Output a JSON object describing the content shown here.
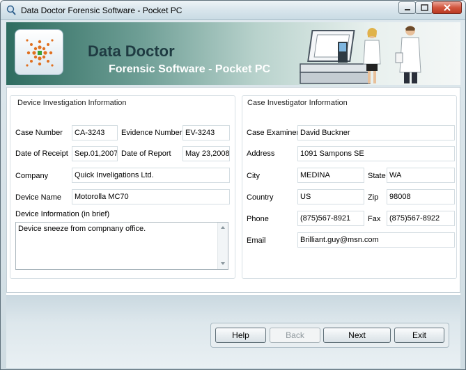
{
  "window": {
    "title": "Data Doctor Forensic Software - Pocket PC"
  },
  "banner": {
    "brand": "Data Doctor",
    "subtitle": "Forensic Software - Pocket PC"
  },
  "device": {
    "section_title": "Device Investigation Information",
    "case_number_label": "Case Number",
    "case_number": "CA-3243",
    "evidence_number_label": "Evidence Number",
    "evidence_number": "EV-3243",
    "date_of_receipt_label": "Date of Receipt",
    "date_of_receipt": "Sep.01,2007",
    "date_of_report_label": "Date of Report",
    "date_of_report": "May 23,2008",
    "company_label": "Company",
    "company": "Quick Inveligations Ltd.",
    "device_name_label": "Device Name",
    "device_name": "Motorolla MC70",
    "info_label": "Device Information (in brief)",
    "info_text": "Device sneeze from compnany office."
  },
  "investigator": {
    "section_title": "Case Investigator Information",
    "examiner_label": "Case Examiner",
    "examiner": "David Buckner",
    "address_label": "Address",
    "address": "1091 Sampons SE",
    "city_label": "City",
    "city": "MEDINA",
    "state_label": "State",
    "state": "WA",
    "country_label": "Country",
    "country": "US",
    "zip_label": "Zip",
    "zip": "98008",
    "phone_label": "Phone",
    "phone": "(875)567-8921",
    "fax_label": "Fax",
    "fax": "(875)567-8922",
    "email_label": "Email",
    "email": "Brilliant.guy@msn.com"
  },
  "buttons": {
    "help": "Help",
    "back": "Back",
    "next": "Next",
    "exit": "Exit"
  },
  "colors": {
    "accent": "#2e6c60",
    "brand_text": "#1f3b42",
    "close_button": "#c9472f"
  }
}
